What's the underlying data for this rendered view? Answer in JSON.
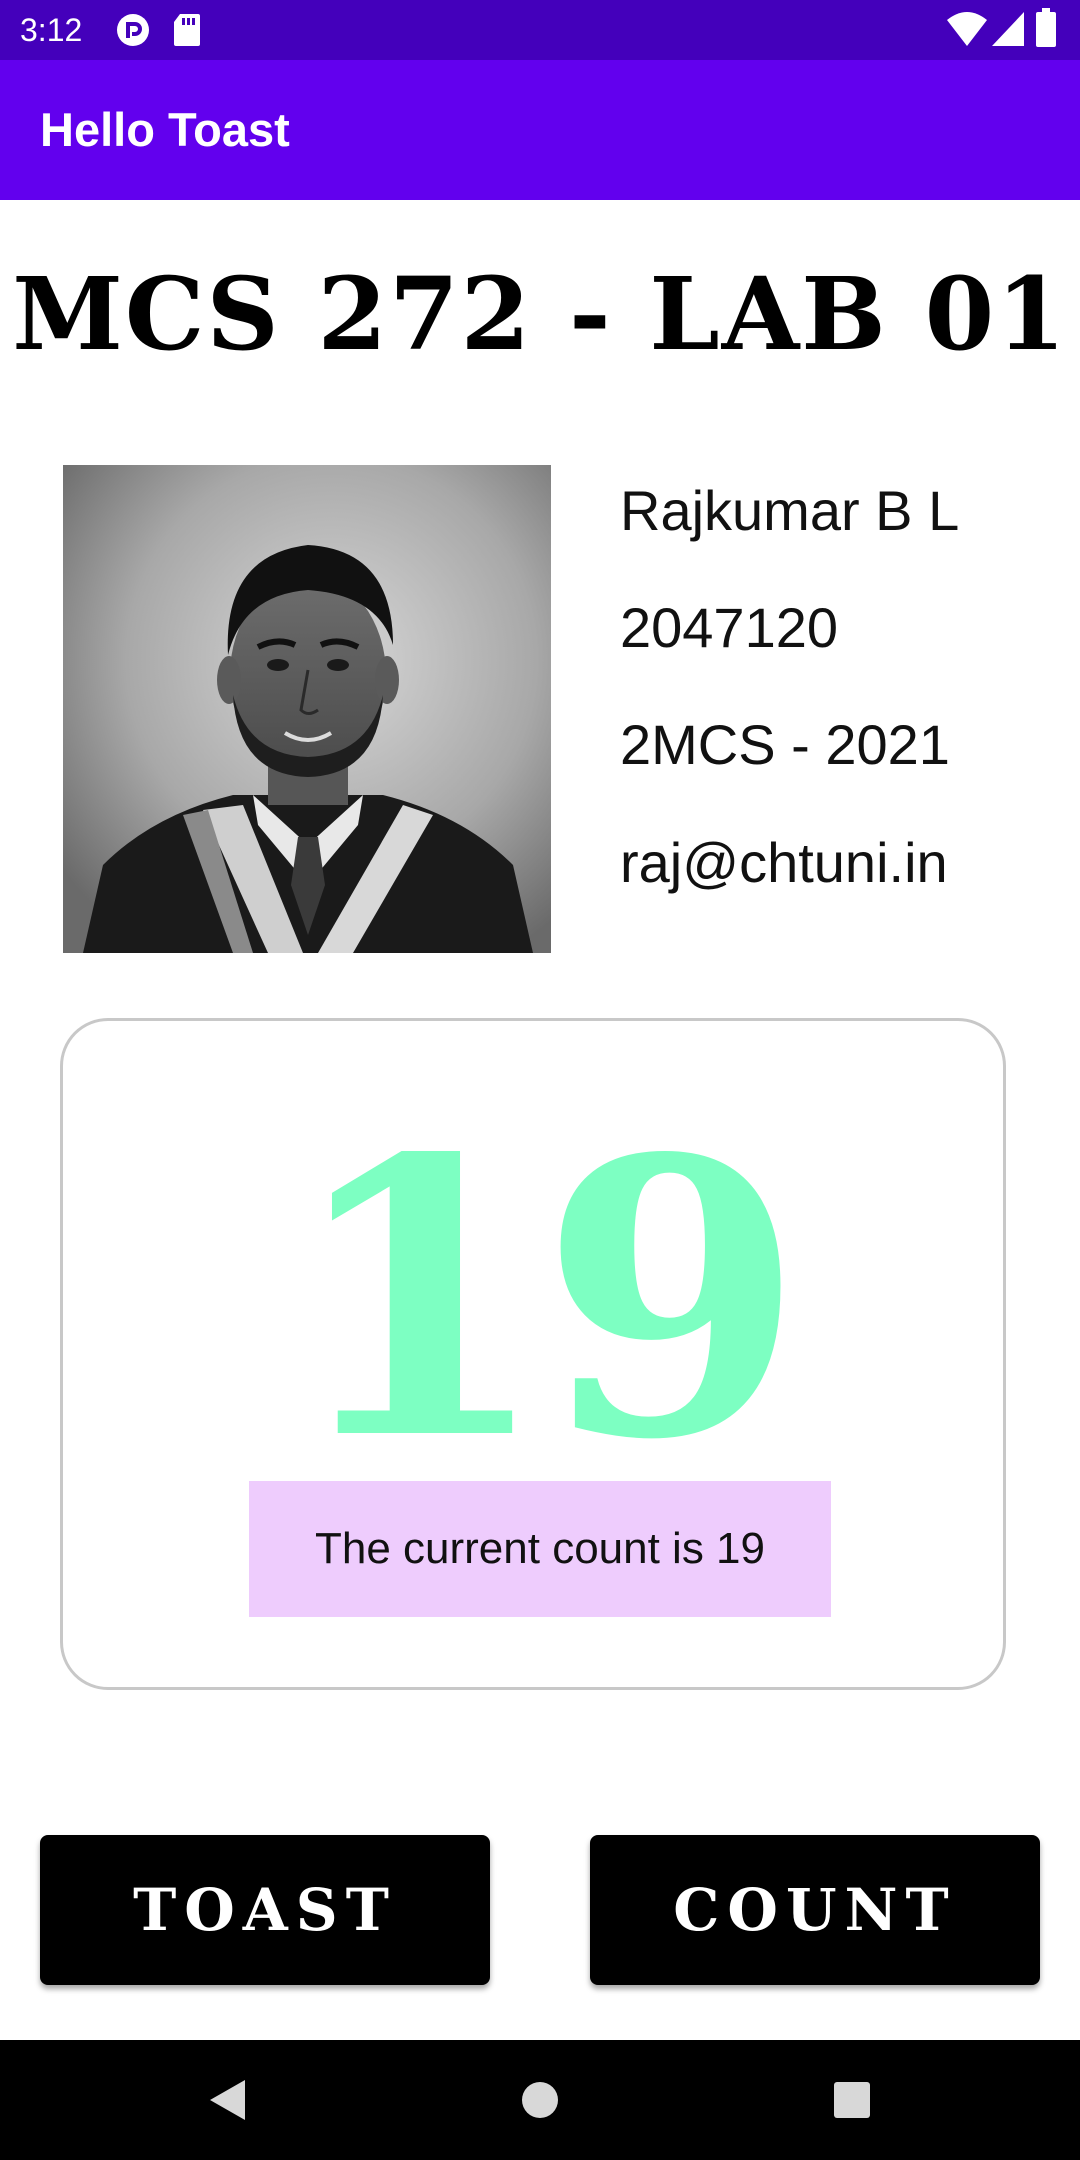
{
  "status_bar": {
    "time": "3:12",
    "icons": [
      "pocket-casts-icon",
      "sd-card-icon",
      "wifi-icon",
      "cellular-signal-icon",
      "battery-icon"
    ]
  },
  "app_bar": {
    "title": "Hello Toast"
  },
  "heading": "MCS 272 - LAB 01",
  "profile": {
    "name": "Rajkumar B L",
    "id": "2047120",
    "class": "2MCS - 2021",
    "email": "raj@chtuni.in"
  },
  "counter": {
    "value": "19",
    "message": "The current count is 19"
  },
  "buttons": {
    "toast_label": "TOAST",
    "count_label": "COUNT"
  },
  "nav_bar": {
    "icons": [
      "back-icon",
      "home-icon",
      "recents-icon"
    ]
  },
  "colors": {
    "status_bar": "#4400bb",
    "app_bar": "#6200ee",
    "count_number": "#7dffc2",
    "count_banner": "#eeccfd",
    "button_bg": "#000000"
  }
}
